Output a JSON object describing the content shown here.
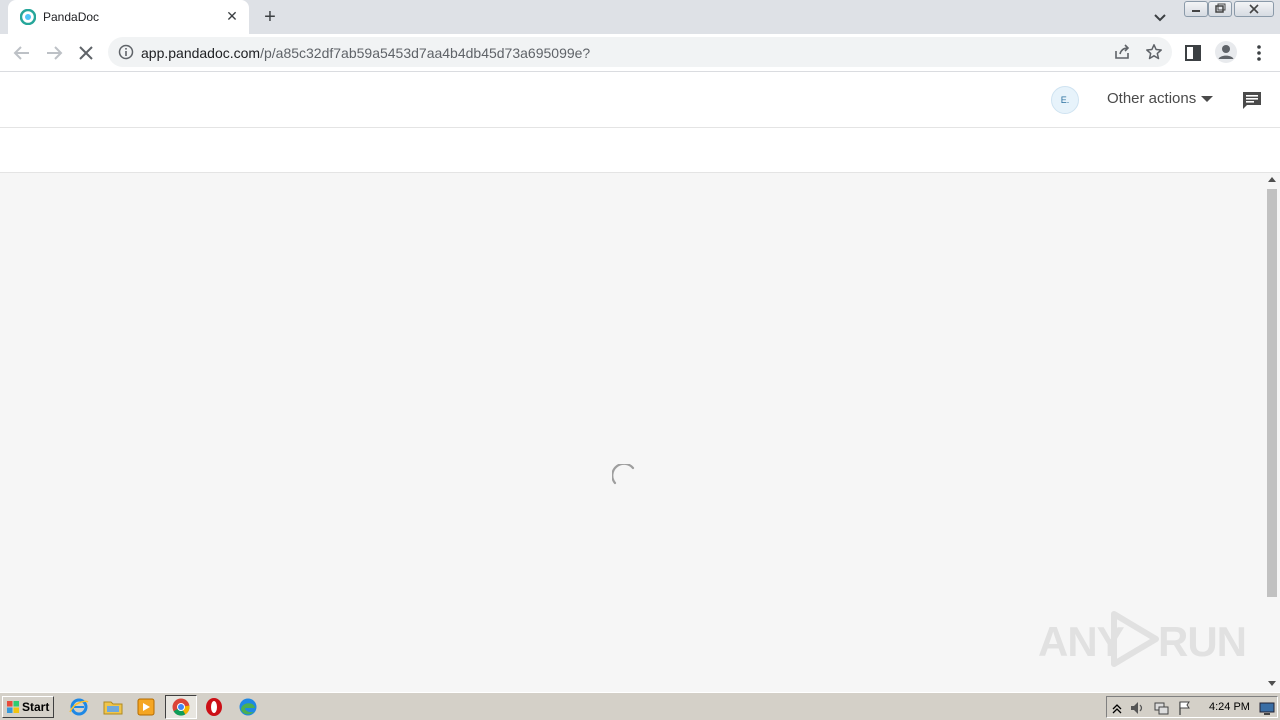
{
  "browser": {
    "tab": {
      "title": "PandaDoc"
    },
    "url": {
      "host": "app.pandadoc.com",
      "path": "/p/a85c32df7ab59a5453d7aa4b4db45d73a695099e?"
    }
  },
  "app": {
    "avatar_initial": "E.",
    "other_actions_label": "Other actions"
  },
  "watermark": {
    "left": "ANY",
    "right": "RUN"
  },
  "taskbar": {
    "start_label": "Start",
    "clock": "4:24 PM"
  },
  "colors": {
    "accent": "#4db6ac",
    "page_bg": "#f6f6f6",
    "tabstrip_bg": "#dee1e6"
  }
}
